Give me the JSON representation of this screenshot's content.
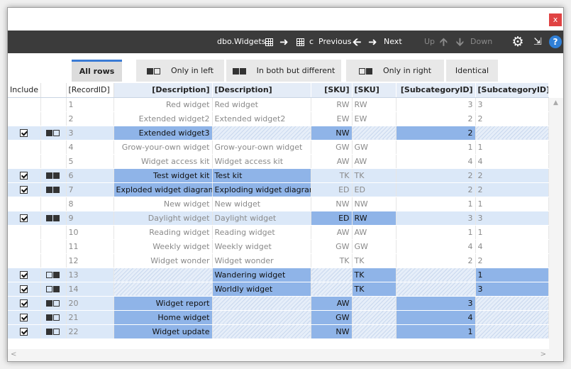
{
  "window": {
    "close_label": "x"
  },
  "toolbar": {
    "table_name": "dbo.Widgets",
    "target_label": "c",
    "previous_label": "Previous",
    "next_label": "Next",
    "up_label": "Up",
    "down_label": "Down",
    "help_label": "?"
  },
  "tabs": [
    {
      "label": "All rows"
    },
    {
      "label": "Only in left"
    },
    {
      "label": "In both but different"
    },
    {
      "label": "Only in right"
    },
    {
      "label": "Identical"
    }
  ],
  "columns": {
    "include": "Include",
    "record_id": "[RecordID]",
    "desc_left": "[Description]",
    "desc_right": "[Description]",
    "sku_left": "[SKU]",
    "sku_right": "[SKU]",
    "sub_left": "[SubcategoryID]",
    "sub_right": "[SubcategoryID]"
  },
  "rows": [
    {
      "id": "1",
      "dl": "Red widget",
      "dr": "Red widget",
      "sl": "RW",
      "sr": "RW",
      "cl": "3",
      "cr": "3"
    },
    {
      "id": "2",
      "dl": "Extended widget2",
      "dr": "Extended widget2",
      "sl": "EW",
      "sr": "EW",
      "cl": "2",
      "cr": "2"
    },
    {
      "id": "3",
      "dl": "Extended widget3",
      "dr": "",
      "sl": "NW",
      "sr": "",
      "cl": "2",
      "cr": ""
    },
    {
      "id": "4",
      "dl": "Grow-your-own widget",
      "dr": "Grow-your-own widget",
      "sl": "GW",
      "sr": "GW",
      "cl": "1",
      "cr": "1"
    },
    {
      "id": "5",
      "dl": "Widget access kit",
      "dr": "Widget access kit",
      "sl": "AW",
      "sr": "AW",
      "cl": "4",
      "cr": "4"
    },
    {
      "id": "6",
      "dl": "Test widget kit",
      "dr": "Test kit",
      "sl": "TK",
      "sr": "TK",
      "cl": "2",
      "cr": "2"
    },
    {
      "id": "7",
      "dl": "Exploded widget diagram",
      "dr": "Exploding widget diagram",
      "sl": "ED",
      "sr": "ED",
      "cl": "2",
      "cr": "2"
    },
    {
      "id": "8",
      "dl": "New widget",
      "dr": "New widget",
      "sl": "NW",
      "sr": "NW",
      "cl": "1",
      "cr": "1"
    },
    {
      "id": "9",
      "dl": "Daylight widget",
      "dr": "Daylight widget",
      "sl": "ED",
      "sr": "RW",
      "cl": "3",
      "cr": "3"
    },
    {
      "id": "10",
      "dl": "Reading widget",
      "dr": "Reading widget",
      "sl": "AW",
      "sr": "AW",
      "cl": "1",
      "cr": "1"
    },
    {
      "id": "11",
      "dl": "Weekly widget",
      "dr": "Weekly widget",
      "sl": "GW",
      "sr": "GW",
      "cl": "4",
      "cr": "4"
    },
    {
      "id": "12",
      "dl": "Widget wonder",
      "dr": "Widget wonder",
      "sl": "TK",
      "sr": "TK",
      "cl": "2",
      "cr": "2"
    },
    {
      "id": "13",
      "dl": "",
      "dr": "Wandering widget",
      "sl": "",
      "sr": "TK",
      "cl": "",
      "cr": "1"
    },
    {
      "id": "14",
      "dl": "",
      "dr": "Worldly widget",
      "sl": "",
      "sr": "TK",
      "cl": "",
      "cr": "3"
    },
    {
      "id": "20",
      "dl": "Widget report",
      "dr": "",
      "sl": "AW",
      "sr": "",
      "cl": "3",
      "cr": ""
    },
    {
      "id": "21",
      "dl": "Home widget",
      "dr": "",
      "sl": "GW",
      "sr": "",
      "cl": "4",
      "cr": ""
    },
    {
      "id": "22",
      "dl": "Widget update",
      "dr": "",
      "sl": "NW",
      "sr": "",
      "cl": "1",
      "cr": ""
    }
  ]
}
